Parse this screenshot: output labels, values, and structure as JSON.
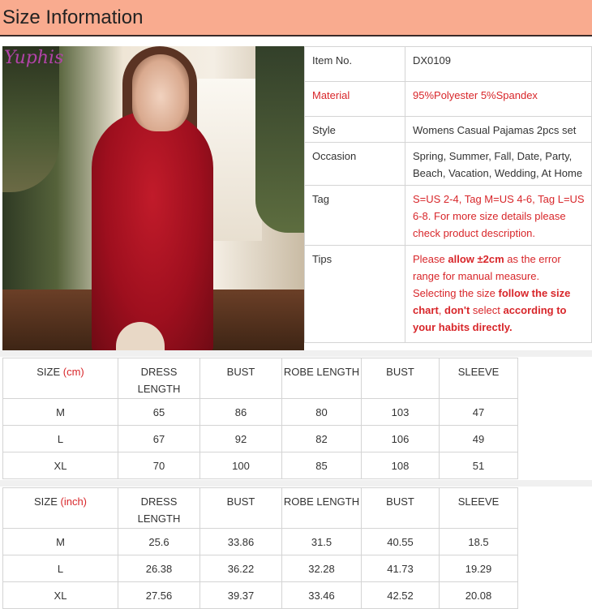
{
  "header": {
    "title": "Size Information",
    "color": "#f9ab8f"
  },
  "photo": {
    "logo": "Yuphis"
  },
  "info": [
    {
      "key": "Item No.",
      "value": "DX0109",
      "red": false
    },
    {
      "key": "Material",
      "value": "95%Polyester 5%Spandex",
      "red": true
    },
    {
      "key": "Style",
      "value": "Womens Casual Pajamas 2pcs set",
      "red": false
    },
    {
      "key": "Occasion",
      "value": "Spring, Summer, Fall, Date, Party, Beach, Vacation, Wedding, At Home",
      "red": false
    },
    {
      "key": "Tag",
      "value": "S=US 2-4, Tag M=US 4-6, Tag L=US 6-8. For more size details please check product description.",
      "red": true
    },
    {
      "key": "Tips",
      "parts": [
        {
          "t": "Please ",
          "b": false
        },
        {
          "t": "allow ±2cm",
          "b": true
        },
        {
          "t": " as the error range for manual measure. Selecting the size ",
          "b": false
        },
        {
          "t": "follow the size chart",
          "b": true
        },
        {
          "t": ", ",
          "b": false
        },
        {
          "t": "don't",
          "b": true
        },
        {
          "t": " select ",
          "b": false
        },
        {
          "t": "according to your habits directly.",
          "b": true
        }
      ]
    }
  ],
  "cm_table": {
    "size_label": "SIZE",
    "unit": "(cm)",
    "headers": [
      "DRESS LENGTH",
      "BUST",
      "ROBE LENGTH",
      "BUST",
      "SLEEVE"
    ],
    "rows": [
      [
        "M",
        "65",
        "86",
        "80",
        "103",
        "47"
      ],
      [
        "L",
        "67",
        "92",
        "82",
        "106",
        "49"
      ],
      [
        "XL",
        "70",
        "100",
        "85",
        "108",
        "51"
      ]
    ]
  },
  "inch_table": {
    "size_label": "SIZE",
    "unit": "(inch)",
    "headers": [
      "DRESS LENGTH",
      "BUST",
      "ROBE LENGTH",
      "BUST",
      "SLEEVE"
    ],
    "rows": [
      [
        "M",
        "25.6",
        "33.86",
        "31.5",
        "40.55",
        "18.5"
      ],
      [
        "L",
        "26.38",
        "36.22",
        "32.28",
        "41.73",
        "19.29"
      ],
      [
        "XL",
        "27.56",
        "39.37",
        "33.46",
        "42.52",
        "20.08"
      ]
    ]
  }
}
